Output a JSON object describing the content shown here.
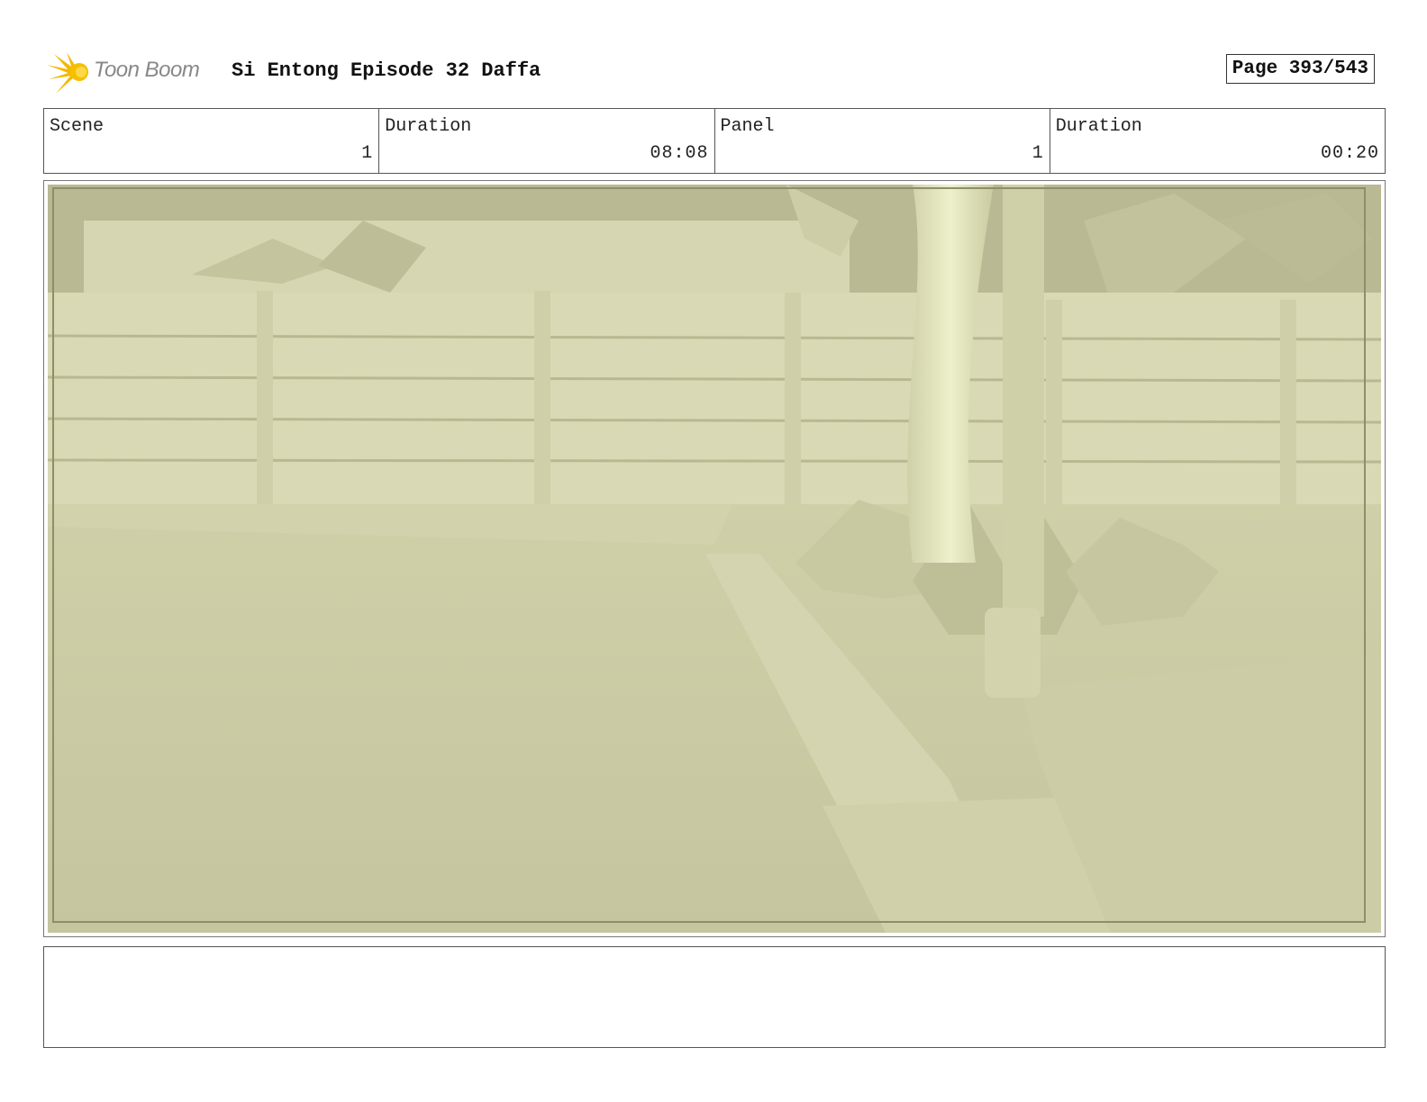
{
  "header": {
    "logo_text": "Toon Boom",
    "project_title": "Si Entong Episode 32 Daffa",
    "page_label": "Page 393/543"
  },
  "info": {
    "scene_label": "Scene",
    "scene_value": "1",
    "scene_duration_label": "Duration",
    "scene_duration_value": "08:08",
    "panel_label": "Panel",
    "panel_value": "1",
    "panel_duration_label": "Duration",
    "panel_duration_value": "00:20"
  },
  "panel": {
    "image_description_icon": "storyboard-backyard-fence-scene",
    "tint_color": "#d8d9b5"
  },
  "notes": {
    "text": ""
  },
  "colors": {
    "logo_flare": "#f5b800",
    "logo_text": "#888888"
  }
}
